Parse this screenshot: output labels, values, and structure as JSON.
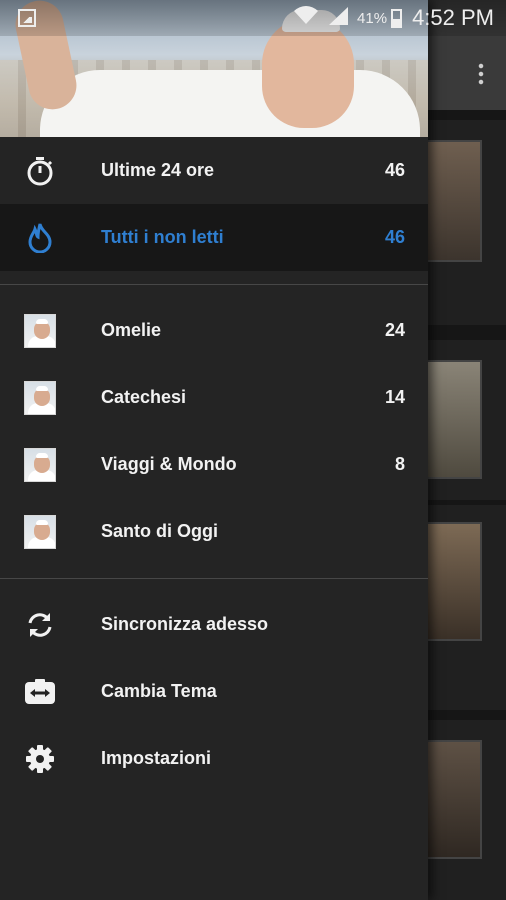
{
  "status_bar": {
    "battery": "41%",
    "time": "4:52 PM"
  },
  "drawer": {
    "section_recent": [
      {
        "label": "Ultime 24 ore",
        "count": "46",
        "icon": "stopwatch-icon"
      },
      {
        "label": "Tutti i non letti",
        "count": "46",
        "icon": "flame-icon",
        "selected": true
      }
    ],
    "section_feeds": [
      {
        "label": "Omelie",
        "count": "24",
        "icon": "pope-thumbnail"
      },
      {
        "label": "Catechesi",
        "count": "14",
        "icon": "pope-thumbnail"
      },
      {
        "label": "Viaggi & Mondo",
        "count": "8",
        "icon": "pope-thumbnail"
      },
      {
        "label": "Santo di Oggi",
        "count": "",
        "icon": "pope-thumbnail"
      }
    ],
    "section_actions": [
      {
        "label": "Sincronizza adesso",
        "icon": "sync-icon"
      },
      {
        "label": "Cambia Tema",
        "icon": "theme-switch-icon"
      },
      {
        "label": "Impostazioni",
        "icon": "gear-icon"
      }
    ]
  },
  "colors": {
    "accent": "#2f7fd1",
    "drawer_bg": "#242424",
    "selected_row_bg": "#171717",
    "text": "#f2f2f2"
  }
}
